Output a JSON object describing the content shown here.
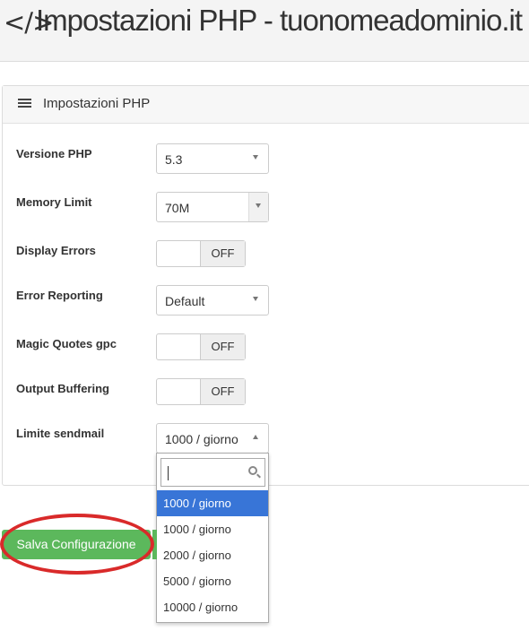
{
  "header": {
    "title": "Impostazioni PHP - tuonomeadominio.it",
    "icon": "code-icon",
    "icon_glyph": "</>"
  },
  "panel": {
    "title": "Impostazioni PHP",
    "icon": "list-icon"
  },
  "settings": {
    "php_version": {
      "label": "Versione PHP",
      "value": "5.3"
    },
    "memory_limit": {
      "label": "Memory Limit",
      "value": "70M"
    },
    "display_errors": {
      "label": "Display Errors",
      "value": "OFF"
    },
    "error_reporting": {
      "label": "Error Reporting",
      "value": "Default"
    },
    "magic_quotes": {
      "label": "Magic Quotes gpc",
      "value": "OFF"
    },
    "output_buffering": {
      "label": "Output Buffering",
      "value": "OFF"
    },
    "sendmail_limit": {
      "label": "Limite sendmail",
      "value": "1000 / giorno"
    }
  },
  "dropdown": {
    "search_value": "",
    "options": [
      "1000 / giorno",
      "1000 / giorno",
      "2000 / giorno",
      "5000 / giorno",
      "10000 / giorno"
    ],
    "selected_index": 0
  },
  "actions": {
    "save_label": "Salva Configurazione"
  },
  "colors": {
    "accent": "#5cb85c",
    "highlight": "#3875d7",
    "annotation": "#d92a2a"
  }
}
